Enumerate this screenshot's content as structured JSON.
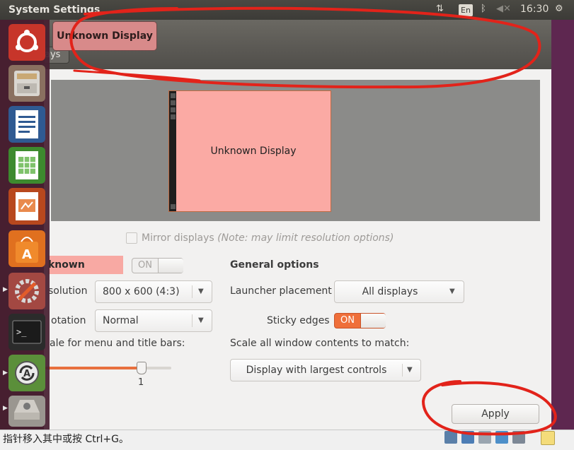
{
  "top_panel": {
    "title": "System Settings",
    "language": "En",
    "clock": "16:30"
  },
  "window": {
    "tab_partial": "ays",
    "tooltip": "Unknown Display"
  },
  "preview": {
    "monitor_label": "Unknown Display"
  },
  "mirror": {
    "label": "Mirror displays",
    "note": "(Note: may limit resolution options)"
  },
  "display_settings": {
    "name": "known Display",
    "toggle_label": "ON",
    "resolution_label": "solution",
    "resolution_value": "800 x 600 (4:3)",
    "rotation_label": "otation",
    "rotation_value": "Normal",
    "scale_label": "ale for menu and title bars:",
    "scale_value": "1"
  },
  "general_options": {
    "heading": "General options",
    "launcher_label": "Launcher placement",
    "launcher_value": "All displays",
    "sticky_label": "Sticky edges",
    "sticky_value": "ON",
    "scale_label": "Scale all window contents to match:",
    "scale_value": "Display with largest controls"
  },
  "apply_label": "Apply",
  "statusbar": {
    "text": "指针移入其中或按 Ctrl+G。"
  },
  "colors": {
    "accent": "#ef6f3a",
    "annotation": "#e2231a",
    "highlight": "#f8a9a3"
  }
}
